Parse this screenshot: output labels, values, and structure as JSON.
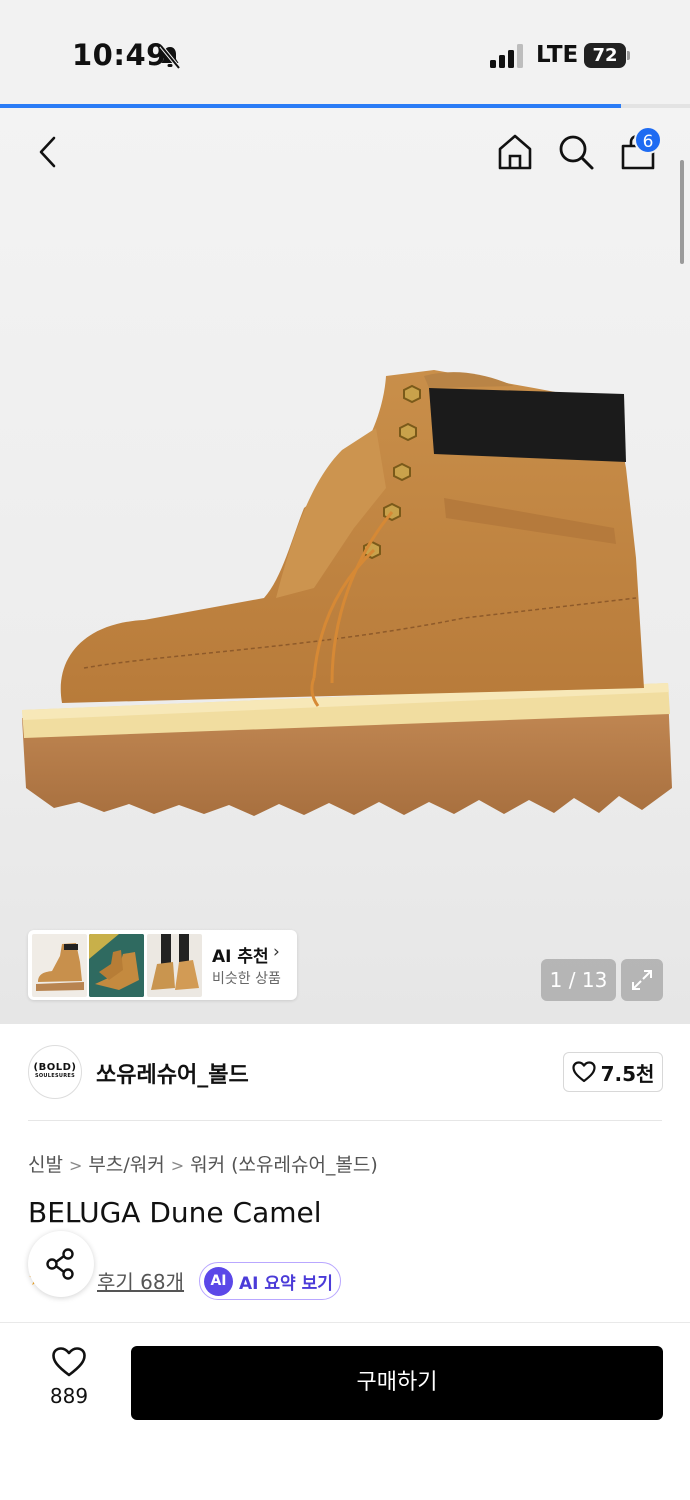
{
  "status_bar": {
    "time": "10:49",
    "network": "LTE",
    "battery": "72",
    "icons": [
      "bell-muted-icon",
      "signal-icon"
    ]
  },
  "page_load_progress": 0.9,
  "header": {
    "icons": [
      "back-arrow-icon",
      "home-icon",
      "search-icon",
      "shopping-bag-icon"
    ],
    "cart_count": "6"
  },
  "gallery": {
    "ai_recommend": {
      "title": "AI 추천",
      "chevron": "›",
      "subtitle": "비슷한 상품"
    },
    "counter": "1 / 13",
    "expand_icon": "expand-icon"
  },
  "brand": {
    "logo_text": "(BOLD)",
    "logo_subtext": "SOULESURES",
    "name": "쏘유레슈어_볼드",
    "like_count": "7.5천"
  },
  "breadcrumb": [
    "신발",
    "부츠/워커",
    "워커 (쏘유레슈어_볼드)"
  ],
  "product": {
    "title": "BELUGA Dune Camel",
    "review_link": "후기 68개",
    "ai_badge": "AI",
    "ai_summary": "AI 요약 보기"
  },
  "bottom_bar": {
    "like_count": "889",
    "buy_label": "구매하기"
  },
  "colors": {
    "accent": "#1e6bf2",
    "ai_purple": "#5b48e8",
    "buy_button": "#000000"
  }
}
